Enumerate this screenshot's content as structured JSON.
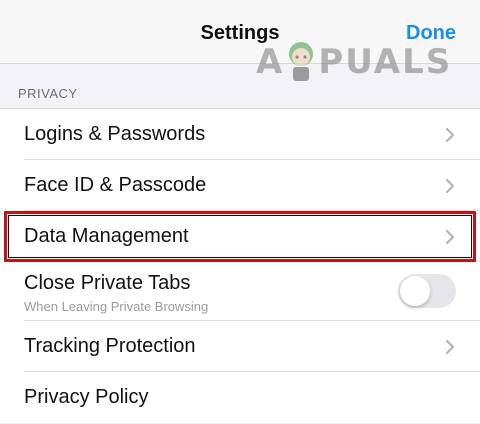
{
  "header": {
    "title": "Settings",
    "done_label": "Done"
  },
  "watermark": {
    "text_a": "A",
    "text_rest": "PUALS"
  },
  "section": {
    "header": "PRIVACY"
  },
  "rows": [
    {
      "label": "Logins & Passwords",
      "accessory": "chevron-right-icon"
    },
    {
      "label": "Face ID & Passcode",
      "accessory": "chevron-right-icon"
    },
    {
      "label": "Data Management",
      "accessory": "chevron-right-icon",
      "highlighted": true
    },
    {
      "label": "Close Private Tabs",
      "sublabel": "When Leaving Private Browsing",
      "toggle_on": false
    },
    {
      "label": "Tracking Protection",
      "accessory": "chevron-right-icon"
    },
    {
      "label": "Privacy Policy"
    }
  ],
  "colors": {
    "accent": "#1a8fe8",
    "highlight": "#c8101a"
  }
}
